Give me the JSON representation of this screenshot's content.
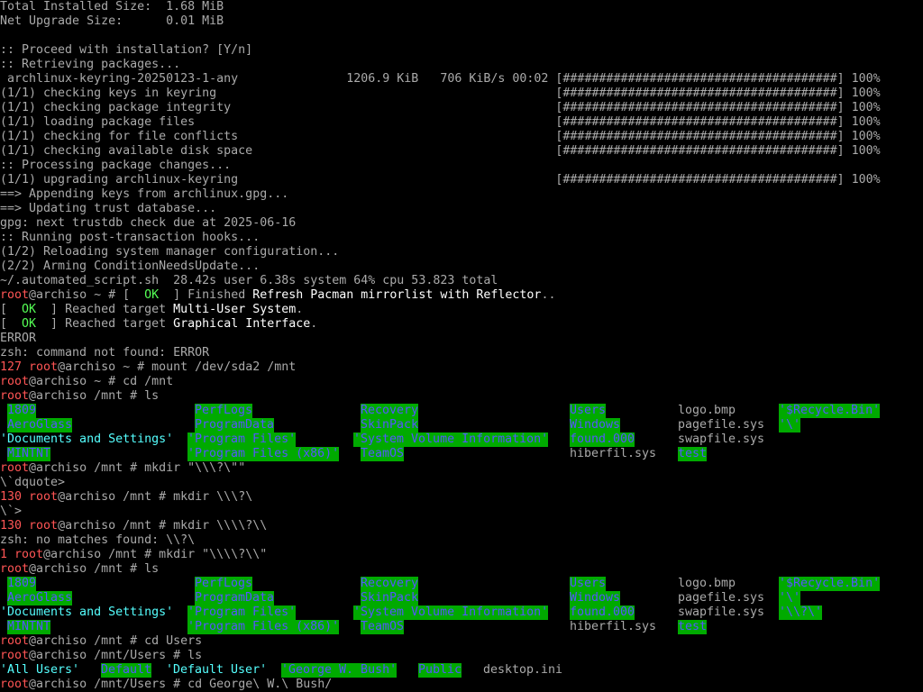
{
  "colors": {
    "bg": "#000000",
    "fg": "#aaaaaa",
    "prompt_red": "#ff5555",
    "bright": "#ffffff",
    "ok_green": "#55ff55",
    "dir_blue": "#5555ff",
    "cyan": "#55ffff",
    "other_writable_bg": "#00aa00"
  },
  "lines": [
    {
      "segs": [
        {
          "t": "Total Installed Size:  1.68 MiB"
        }
      ]
    },
    {
      "segs": [
        {
          "t": "Net Upgrade Size:      0.01 MiB"
        }
      ]
    },
    {
      "segs": [
        {
          "t": ""
        }
      ]
    },
    {
      "segs": [
        {
          "t": ":: Proceed with installation? [Y/n]"
        }
      ]
    },
    {
      "segs": [
        {
          "t": ":: Retrieving packages..."
        }
      ]
    },
    {
      "segs": [
        {
          "t": " archlinux-keyring-20250123-1-any               1206.9 KiB   706 KiB/s 00:02 [######################################] 100%"
        }
      ]
    },
    {
      "segs": [
        {
          "t": "(1/1) checking keys in keyring                                               [######################################] 100%"
        }
      ]
    },
    {
      "segs": [
        {
          "t": "(1/1) checking package integrity                                             [######################################] 100%"
        }
      ]
    },
    {
      "segs": [
        {
          "t": "(1/1) loading package files                                                  [######################################] 100%"
        }
      ]
    },
    {
      "segs": [
        {
          "t": "(1/1) checking for file conflicts                                            [######################################] 100%"
        }
      ]
    },
    {
      "segs": [
        {
          "t": "(1/1) checking available disk space                                          [######################################] 100%"
        }
      ]
    },
    {
      "segs": [
        {
          "t": ":: Processing package changes..."
        }
      ]
    },
    {
      "segs": [
        {
          "t": "(1/1) upgrading archlinux-keyring                                            [######################################] 100%"
        }
      ]
    },
    {
      "segs": [
        {
          "t": "==> Appending keys from archlinux.gpg..."
        }
      ]
    },
    {
      "segs": [
        {
          "t": "==> Updating trust database..."
        }
      ]
    },
    {
      "segs": [
        {
          "t": "gpg: next trustdb check due at 2025-06-16"
        }
      ]
    },
    {
      "segs": [
        {
          "t": ":: Running post-transaction hooks..."
        }
      ]
    },
    {
      "segs": [
        {
          "t": "(1/2) Reloading system manager configuration..."
        }
      ]
    },
    {
      "segs": [
        {
          "t": "(2/2) Arming ConditionNeedsUpdate..."
        }
      ]
    },
    {
      "segs": [
        {
          "t": "~/.automated_script.sh  28.42s user 6.38s system 64% cpu 53.823 total"
        }
      ]
    },
    {
      "segs": [
        {
          "t": "root",
          "c": "red"
        },
        {
          "t": "@archiso ~ # [  "
        },
        {
          "t": "OK",
          "c": "green"
        },
        {
          "t": "  ] Finished "
        },
        {
          "t": "Refresh Pacman mirrorlist with Reflector",
          "c": "white"
        },
        {
          "t": ".."
        }
      ]
    },
    {
      "segs": [
        {
          "t": "[  "
        },
        {
          "t": "OK",
          "c": "green"
        },
        {
          "t": "  ] Reached target "
        },
        {
          "t": "Multi-User System",
          "c": "white"
        },
        {
          "t": "."
        }
      ]
    },
    {
      "segs": [
        {
          "t": "[  "
        },
        {
          "t": "OK",
          "c": "green"
        },
        {
          "t": "  ] Reached target "
        },
        {
          "t": "Graphical Interface",
          "c": "white"
        },
        {
          "t": "."
        }
      ]
    },
    {
      "segs": [
        {
          "t": "ERROR"
        }
      ]
    },
    {
      "segs": [
        {
          "t": "zsh: command not found: ERROR"
        }
      ]
    },
    {
      "segs": [
        {
          "t": "127 ",
          "c": "red"
        },
        {
          "t": "root",
          "c": "red"
        },
        {
          "t": "@archiso ~ # mount /dev/sda2 /mnt"
        }
      ]
    },
    {
      "segs": [
        {
          "t": "root",
          "c": "red"
        },
        {
          "t": "@archiso ~ # cd /mnt"
        }
      ]
    },
    {
      "segs": [
        {
          "t": "root",
          "c": "red"
        },
        {
          "t": "@archiso /mnt # ls"
        }
      ]
    },
    {
      "cells": [
        {
          "t": "1809",
          "c": "hl",
          "col": 1
        },
        {
          "t": "PerfLogs",
          "c": "hl",
          "col": 27
        },
        {
          "t": "Recovery",
          "c": "hl",
          "col": 50
        },
        {
          "t": "Users",
          "c": "hl",
          "col": 79
        },
        {
          "t": "logo.bmp",
          "col": 94
        },
        {
          "t": "'$Recycle.Bin'",
          "c": "hl",
          "col": 108
        }
      ]
    },
    {
      "cells": [
        {
          "t": "AeroGlass",
          "c": "hl",
          "col": 1
        },
        {
          "t": "ProgramData",
          "c": "hl",
          "col": 27
        },
        {
          "t": "SkinPack",
          "c": "hl",
          "col": 50
        },
        {
          "t": "Windows",
          "c": "hl",
          "col": 79
        },
        {
          "t": "pagefile.sys",
          "col": 94
        },
        {
          "t": "'\\'",
          "c": "hl",
          "col": 108
        }
      ]
    },
    {
      "cells": [
        {
          "t": "'Documents and Settings'",
          "c": "cyan",
          "col": 0
        },
        {
          "t": "'Program Files'",
          "c": "hl",
          "col": 26
        },
        {
          "t": "'System Volume Information'",
          "c": "hl",
          "col": 49
        },
        {
          "t": "found.000",
          "c": "hl",
          "col": 79
        },
        {
          "t": "swapfile.sys",
          "col": 94
        }
      ]
    },
    {
      "cells": [
        {
          "t": "MINTNT",
          "c": "hl",
          "col": 1
        },
        {
          "t": "'Program Files (x86)'",
          "c": "hl",
          "col": 26
        },
        {
          "t": "TeamOS",
          "c": "hl",
          "col": 50
        },
        {
          "t": "hiberfil.sys",
          "col": 79
        },
        {
          "t": "test",
          "c": "hl",
          "col": 94
        }
      ]
    },
    {
      "segs": [
        {
          "t": "root",
          "c": "red"
        },
        {
          "t": "@archiso /mnt # mkdir \"\\\\\\?\\\"\""
        }
      ]
    },
    {
      "segs": [
        {
          "t": "\\`dquote>"
        }
      ]
    },
    {
      "segs": [
        {
          "t": "130 ",
          "c": "red"
        },
        {
          "t": "root",
          "c": "red"
        },
        {
          "t": "@archiso /mnt # mkdir \\\\\\?\\"
        }
      ]
    },
    {
      "segs": [
        {
          "t": "\\`>"
        }
      ]
    },
    {
      "segs": [
        {
          "t": "130 ",
          "c": "red"
        },
        {
          "t": "root",
          "c": "red"
        },
        {
          "t": "@archiso /mnt # mkdir \\\\\\\\?\\\\"
        }
      ]
    },
    {
      "segs": [
        {
          "t": "zsh: no matches found: \\\\?\\"
        }
      ]
    },
    {
      "segs": [
        {
          "t": "1 ",
          "c": "red"
        },
        {
          "t": "root",
          "c": "red"
        },
        {
          "t": "@archiso /mnt # mkdir \"\\\\\\\\?\\\\\""
        }
      ]
    },
    {
      "segs": [
        {
          "t": "root",
          "c": "red"
        },
        {
          "t": "@archiso /mnt # ls"
        }
      ]
    },
    {
      "cells": [
        {
          "t": "1809",
          "c": "hl",
          "col": 1
        },
        {
          "t": "PerfLogs",
          "c": "hl",
          "col": 27
        },
        {
          "t": "Recovery",
          "c": "hl",
          "col": 50
        },
        {
          "t": "Users",
          "c": "hl",
          "col": 79
        },
        {
          "t": "logo.bmp",
          "col": 94
        },
        {
          "t": "'$Recycle.Bin'",
          "c": "hl",
          "col": 108
        }
      ]
    },
    {
      "cells": [
        {
          "t": "AeroGlass",
          "c": "hl",
          "col": 1
        },
        {
          "t": "ProgramData",
          "c": "hl",
          "col": 27
        },
        {
          "t": "SkinPack",
          "c": "hl",
          "col": 50
        },
        {
          "t": "Windows",
          "c": "hl",
          "col": 79
        },
        {
          "t": "pagefile.sys",
          "col": 94
        },
        {
          "t": "'\\'",
          "c": "hl",
          "col": 108
        }
      ]
    },
    {
      "cells": [
        {
          "t": "'Documents and Settings'",
          "c": "cyan",
          "col": 0
        },
        {
          "t": "'Program Files'",
          "c": "hl",
          "col": 26
        },
        {
          "t": "'System Volume Information'",
          "c": "hl",
          "col": 49
        },
        {
          "t": "found.000",
          "c": "hl",
          "col": 79
        },
        {
          "t": "swapfile.sys",
          "col": 94
        },
        {
          "t": "'\\\\?\\'",
          "c": "hl",
          "col": 108
        }
      ]
    },
    {
      "cells": [
        {
          "t": "MINTNT",
          "c": "hl",
          "col": 1
        },
        {
          "t": "'Program Files (x86)'",
          "c": "hl",
          "col": 26
        },
        {
          "t": "TeamOS",
          "c": "hl",
          "col": 50
        },
        {
          "t": "hiberfil.sys",
          "col": 79
        },
        {
          "t": "test",
          "c": "hl",
          "col": 94
        }
      ]
    },
    {
      "segs": [
        {
          "t": "root",
          "c": "red"
        },
        {
          "t": "@archiso /mnt # cd Users"
        }
      ]
    },
    {
      "segs": [
        {
          "t": "root",
          "c": "red"
        },
        {
          "t": "@archiso /mnt/Users # ls"
        }
      ]
    },
    {
      "cells": [
        {
          "t": "'All Users'",
          "c": "cyan",
          "col": 0
        },
        {
          "t": "Default",
          "c": "hl",
          "col": 14
        },
        {
          "t": "'Default User'",
          "c": "cyan",
          "col": 23
        },
        {
          "t": "'George W. Bush'",
          "c": "hl",
          "col": 39
        },
        {
          "t": "Public",
          "c": "hl",
          "col": 58
        },
        {
          "t": "desktop.ini",
          "col": 67
        }
      ]
    },
    {
      "segs": [
        {
          "t": "root",
          "c": "red"
        },
        {
          "t": "@archiso /mnt/Users # cd George\\ W.\\ Bush/"
        }
      ]
    }
  ]
}
